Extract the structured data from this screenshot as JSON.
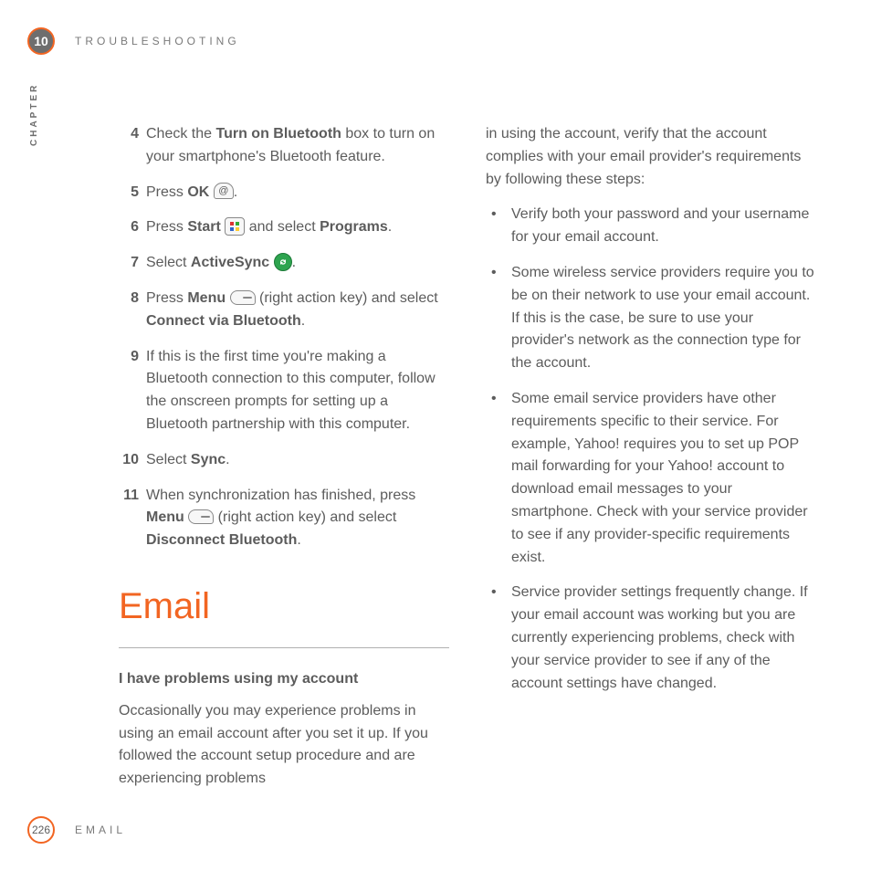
{
  "header": {
    "chapter_number": "10",
    "title": "TROUBLESHOOTING"
  },
  "chapter_vertical": "CHAPTER",
  "footer": {
    "page_number": "226",
    "section": "EMAIL"
  },
  "left_col": {
    "steps": [
      {
        "n": "4",
        "pre": "Check the ",
        "b1": "Turn on Bluetooth",
        "post": " box to turn on your smartphone's Bluetooth feature."
      },
      {
        "n": "5",
        "pre": "Press ",
        "b1": "OK",
        "icon": "ok",
        "post": "."
      },
      {
        "n": "6",
        "pre": "Press ",
        "b1": "Start",
        "icon": "start",
        "mid": " and select ",
        "b2": "Programs",
        "post": "."
      },
      {
        "n": "7",
        "pre": "Select ",
        "b1": "ActiveSync",
        "icon": "sync",
        "post": "."
      },
      {
        "n": "8",
        "pre": "Press ",
        "b1": "Menu",
        "icon": "menu",
        "mid": " (right action key) and select ",
        "b2": "Connect via Bluetooth",
        "post": "."
      },
      {
        "n": "9",
        "pre": "If this is the first time you're making a Bluetooth connection to this computer, follow the onscreen prompts for setting up a Bluetooth partnership with this computer."
      },
      {
        "n": "10",
        "pre": "Select ",
        "b1": "Sync",
        "post": "."
      },
      {
        "n": "11",
        "pre": "When synchronization has finished, press ",
        "b1": "Menu",
        "icon": "menu",
        "mid": " (right action key) and select ",
        "b2": "Disconnect Bluetooth",
        "post": "."
      }
    ],
    "section_heading": "Email",
    "sub_heading": "I have problems using my account",
    "sub_para": "Occasionally you may experience problems in using an email account after you set it up. If you followed the account setup procedure and are experiencing problems"
  },
  "right_col": {
    "intro": "in using the account, verify that the account complies with your email provider's requirements by following these steps:",
    "bullets": [
      "Verify both your password and your username for your email account.",
      "Some wireless service providers require you to be on their network to use your email account. If this is the case, be sure to use your provider's network as the connection type for the account.",
      "Some email service providers have other requirements specific to their service. For example, Yahoo! requires you to set up POP mail forwarding for your Yahoo! account to download email messages to your smartphone. Check with your service provider to see if any provider-specific requirements exist.",
      "Service provider settings frequently change. If your email account was working but you are currently experiencing problems, check with your service provider to see if any of the account settings have changed."
    ]
  }
}
